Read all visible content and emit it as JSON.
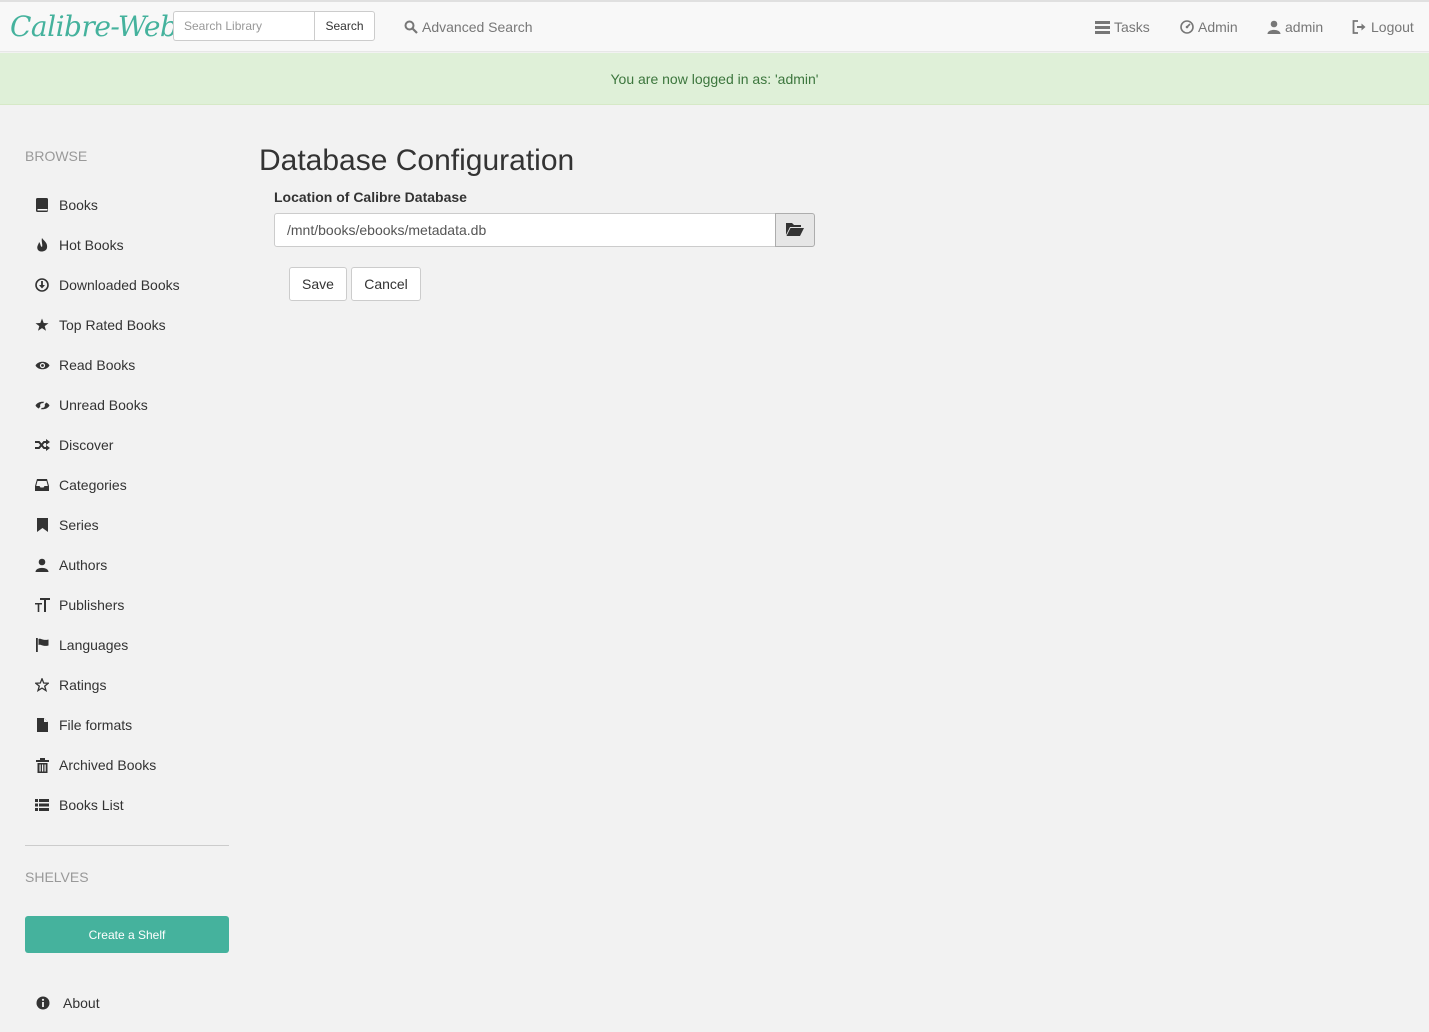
{
  "navbar": {
    "brand": "Calibre-Web",
    "search_placeholder": "Search Library",
    "search_button": "Search",
    "advanced_search": "Advanced Search",
    "tasks": "Tasks",
    "admin": "Admin",
    "user": "admin",
    "logout": "Logout"
  },
  "alert": {
    "message": "You are now logged in as: 'admin'"
  },
  "sidebar": {
    "browse_heading": "BROWSE",
    "items": [
      {
        "label": "Books",
        "icon": "book-icon"
      },
      {
        "label": "Hot Books",
        "icon": "fire-icon"
      },
      {
        "label": "Downloaded Books",
        "icon": "download-icon"
      },
      {
        "label": "Top Rated Books",
        "icon": "star-icon"
      },
      {
        "label": "Read Books",
        "icon": "eye-open-icon"
      },
      {
        "label": "Unread Books",
        "icon": "eye-close-icon"
      },
      {
        "label": "Discover",
        "icon": "random-icon"
      },
      {
        "label": "Categories",
        "icon": "inbox-icon"
      },
      {
        "label": "Series",
        "icon": "bookmark-icon"
      },
      {
        "label": "Authors",
        "icon": "user-icon"
      },
      {
        "label": "Publishers",
        "icon": "text-size-icon"
      },
      {
        "label": "Languages",
        "icon": "flag-icon"
      },
      {
        "label": "Ratings",
        "icon": "star-empty-icon"
      },
      {
        "label": "File formats",
        "icon": "file-icon"
      },
      {
        "label": "Archived Books",
        "icon": "trash-icon"
      },
      {
        "label": "Books List",
        "icon": "list-icon"
      }
    ],
    "shelves_heading": "SHELVES",
    "create_shelf": "Create a Shelf",
    "about": "About"
  },
  "main": {
    "title": "Database Configuration",
    "db_label": "Location of Calibre Database",
    "db_path": "/mnt/books/ebooks/metadata.db",
    "save": "Save",
    "cancel": "Cancel"
  },
  "colors": {
    "accent": "#45b29d",
    "alert_bg": "#dff0d8",
    "alert_text": "#3c763d",
    "background": "#f2f2f2"
  }
}
